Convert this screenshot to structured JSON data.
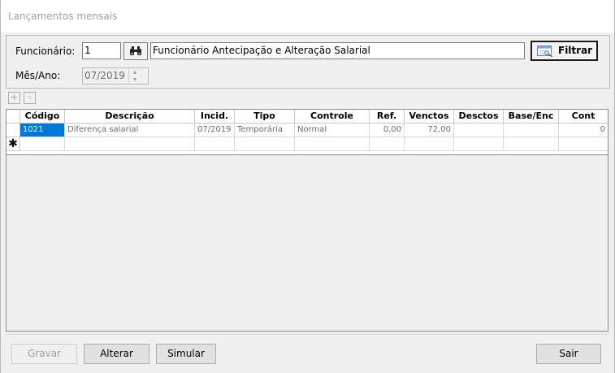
{
  "window": {
    "title": "Lançamentos mensais"
  },
  "filter": {
    "employee_label": "Funcionário:",
    "employee_code": "1",
    "employee_name": "Funcionário Antecipação e Alteração Salarial",
    "period_label": "Mês/Ano:",
    "period_value": "07/2019",
    "filter_button": "Filtrar"
  },
  "grid_toolbar": {
    "add": "+",
    "remove": "-"
  },
  "table": {
    "columns": [
      "Código",
      "Descrição",
      "Incid.",
      "Tipo",
      "Controle",
      "Ref.",
      "Venctos",
      "Desctos",
      "Base/Enc",
      "Cont"
    ],
    "rows": [
      {
        "codigo": "1021",
        "descricao": "Diferença salarial",
        "incid": "07/2019",
        "tipo": "Temporária",
        "controle": "Normal",
        "ref": "0,00",
        "venctos": "72,00",
        "desctos": "",
        "base_enc": "",
        "cont": "0"
      }
    ],
    "new_row_marker": "✱"
  },
  "actions": {
    "save": "Gravar",
    "alter": "Alterar",
    "simulate": "Simular",
    "exit": "Sair"
  },
  "icons": {
    "search": "binoculars-icon",
    "filter": "filter-window-icon"
  }
}
